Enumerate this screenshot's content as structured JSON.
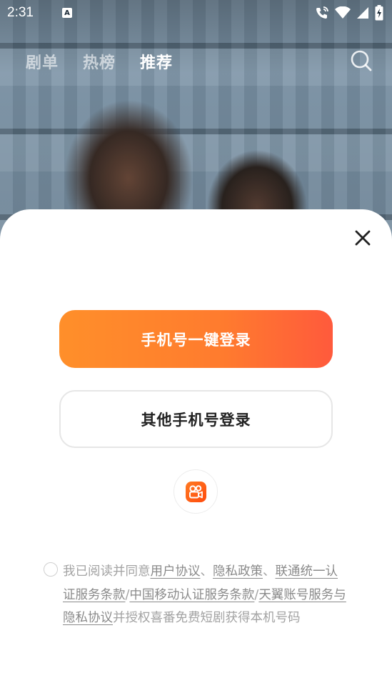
{
  "status_bar": {
    "time": "2:31",
    "input_indicator": "A",
    "icons": [
      "call-wifi-icon",
      "wifi-icon",
      "signal-icon",
      "battery-charging-icon"
    ]
  },
  "top_nav": {
    "tabs": [
      {
        "label": "剧单",
        "active": false
      },
      {
        "label": "热榜",
        "active": false
      },
      {
        "label": "推荐",
        "active": true
      }
    ],
    "search_icon": "search-icon"
  },
  "login_sheet": {
    "close_icon": "close-icon",
    "one_click_login_label": "手机号一键登录",
    "other_phone_login_label": "其他手机号登录",
    "third_party_icon": "kuaishou-icon",
    "agreement": {
      "prefix": "我已阅读并同意",
      "user_agreement": "用户协议",
      "sep1": "、",
      "privacy_policy": "隐私政策",
      "sep2": "、",
      "unicom_terms": "联通统一认证服务条款",
      "sep3": "/",
      "cmcc_terms": "中国移动认证服务条款",
      "sep4": "/",
      "telecom_terms": "天翼账号服务与隐私协议",
      "suffix": "并授权喜番免费短剧获得本机号码"
    }
  },
  "colors": {
    "primary_gradient_start": "#ff8f2a",
    "primary_gradient_end": "#ff5a3c",
    "agreement_text": "#a3a3a3"
  }
}
